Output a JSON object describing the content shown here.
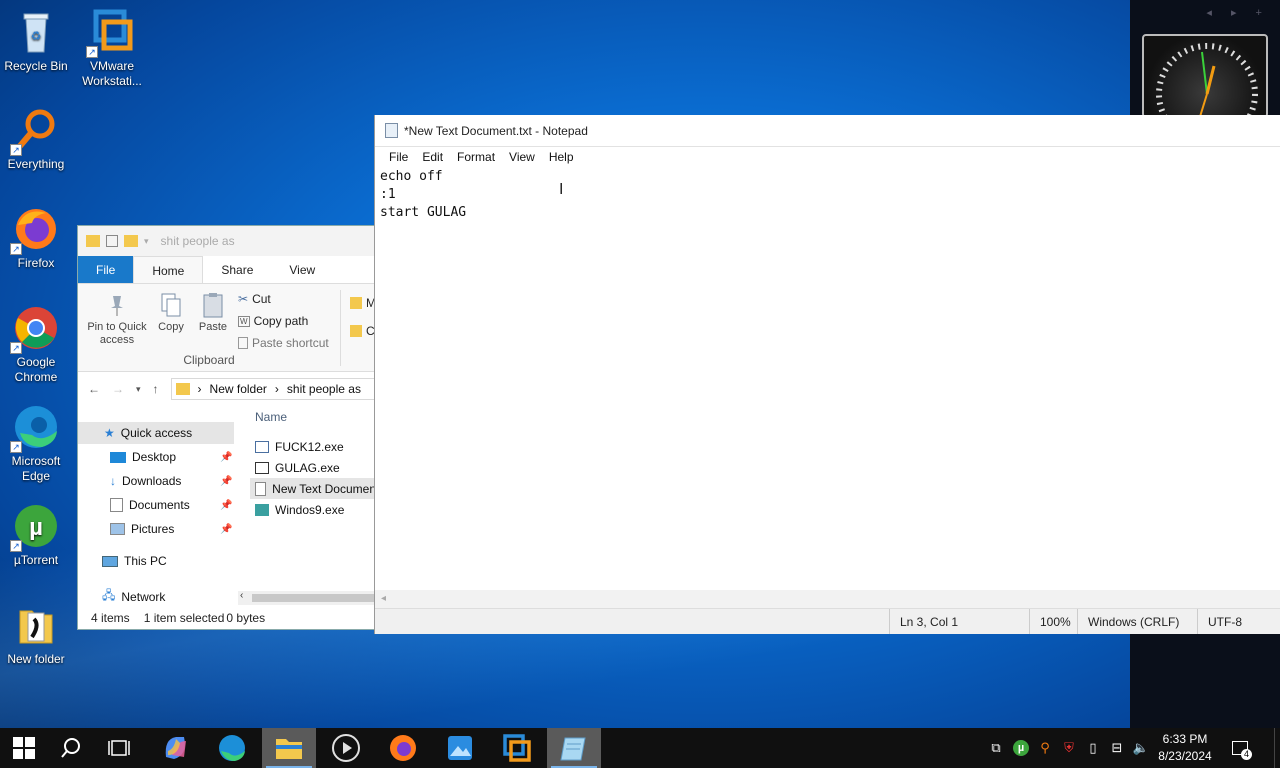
{
  "desktop": {
    "icons": [
      {
        "label": "Recycle Bin",
        "icon": "recycle-bin-icon"
      },
      {
        "label": "VMware Workstati...",
        "icon": "vmware-icon"
      },
      {
        "label": "Everything",
        "icon": "everything-search-icon"
      },
      {
        "label": "Firefox",
        "icon": "firefox-icon"
      },
      {
        "label": "Google Chrome",
        "icon": "chrome-icon"
      },
      {
        "label": "Microsoft Edge",
        "icon": "edge-icon"
      },
      {
        "label": "µTorrent",
        "icon": "utorrent-icon"
      },
      {
        "label": "New folder",
        "icon": "folder-icon"
      }
    ]
  },
  "explorer": {
    "title": "shit people as",
    "tabs": {
      "file": "File",
      "home": "Home",
      "share": "Share",
      "view": "View"
    },
    "ribbon": {
      "pin": "Pin to Quick access",
      "copy": "Copy",
      "paste": "Paste",
      "cut": "Cut",
      "copy_path": "Copy path",
      "paste_shortcut": "Paste shortcut",
      "group": "Clipboard",
      "move": "M",
      "copy_to": "C"
    },
    "address": {
      "crumb1": "New folder",
      "crumb2": "shit people as"
    },
    "nav": {
      "quick_access": "Quick access",
      "desktop": "Desktop",
      "downloads": "Downloads",
      "documents": "Documents",
      "pictures": "Pictures",
      "this_pc": "This PC",
      "network": "Network"
    },
    "column_name": "Name",
    "files": [
      "FUCK12.exe",
      "GULAG.exe",
      "New Text Documen",
      "Windos9.exe"
    ],
    "status": {
      "count": "4 items",
      "selected": "1 item selected",
      "size": "0 bytes"
    }
  },
  "notepad": {
    "title": "*New Text Document.txt - Notepad",
    "menu": {
      "file": "File",
      "edit": "Edit",
      "format": "Format",
      "view": "View",
      "help": "Help"
    },
    "content": "echo off\n:1\nstart GULAG",
    "status": {
      "position": "Ln 3, Col 1",
      "zoom": "100%",
      "eol": "Windows (CRLF)",
      "encoding": "UTF-8"
    }
  },
  "taskbar": {
    "time": "6:33 PM",
    "date": "8/23/2024",
    "notifications": "4",
    "accent": "#7ab4ea"
  }
}
